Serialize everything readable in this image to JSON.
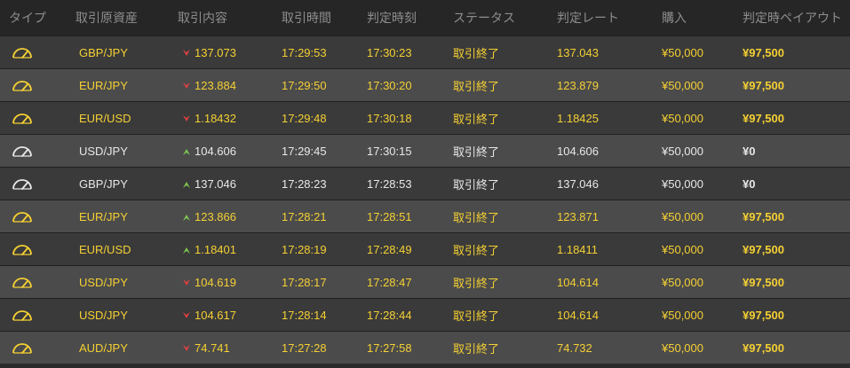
{
  "headers": [
    "タイプ",
    "取引原資産",
    "取引内容",
    "取引時間",
    "判定時刻",
    "ステータス",
    "判定レート",
    "購入",
    "判定時ペイアウト"
  ],
  "colors": {
    "win_text": "#f5d033",
    "lose_text": "#e8e8e8",
    "header_text": "#8d8d8d",
    "arrow_down": "#e04040",
    "arrow_up": "#7ec850"
  },
  "rows": [
    {
      "icon": "gauge-icon",
      "asset": "GBP/JPY",
      "dir": "down",
      "rate": "137.073",
      "time": "17:29:53",
      "judge_time": "17:30:23",
      "status": "取引終了",
      "judge_rate": "137.043",
      "purchase": "¥50,000",
      "payout": "¥97,500",
      "result": "win"
    },
    {
      "icon": "gauge-icon",
      "asset": "EUR/JPY",
      "dir": "down",
      "rate": "123.884",
      "time": "17:29:50",
      "judge_time": "17:30:20",
      "status": "取引終了",
      "judge_rate": "123.879",
      "purchase": "¥50,000",
      "payout": "¥97,500",
      "result": "win"
    },
    {
      "icon": "gauge-icon",
      "asset": "EUR/USD",
      "dir": "down",
      "rate": "1.18432",
      "time": "17:29:48",
      "judge_time": "17:30:18",
      "status": "取引終了",
      "judge_rate": "1.18425",
      "purchase": "¥50,000",
      "payout": "¥97,500",
      "result": "win"
    },
    {
      "icon": "gauge-icon",
      "asset": "USD/JPY",
      "dir": "up",
      "rate": "104.606",
      "time": "17:29:45",
      "judge_time": "17:30:15",
      "status": "取引終了",
      "judge_rate": "104.606",
      "purchase": "¥50,000",
      "payout": "¥0",
      "result": "lose"
    },
    {
      "icon": "gauge-icon",
      "asset": "GBP/JPY",
      "dir": "up",
      "rate": "137.046",
      "time": "17:28:23",
      "judge_time": "17:28:53",
      "status": "取引終了",
      "judge_rate": "137.046",
      "purchase": "¥50,000",
      "payout": "¥0",
      "result": "lose"
    },
    {
      "icon": "gauge-icon",
      "asset": "EUR/JPY",
      "dir": "up",
      "rate": "123.866",
      "time": "17:28:21",
      "judge_time": "17:28:51",
      "status": "取引終了",
      "judge_rate": "123.871",
      "purchase": "¥50,000",
      "payout": "¥97,500",
      "result": "win"
    },
    {
      "icon": "gauge-icon",
      "asset": "EUR/USD",
      "dir": "up",
      "rate": "1.18401",
      "time": "17:28:19",
      "judge_time": "17:28:49",
      "status": "取引終了",
      "judge_rate": "1.18411",
      "purchase": "¥50,000",
      "payout": "¥97,500",
      "result": "win"
    },
    {
      "icon": "gauge-icon",
      "asset": "USD/JPY",
      "dir": "down",
      "rate": "104.619",
      "time": "17:28:17",
      "judge_time": "17:28:47",
      "status": "取引終了",
      "judge_rate": "104.614",
      "purchase": "¥50,000",
      "payout": "¥97,500",
      "result": "win"
    },
    {
      "icon": "gauge-icon",
      "asset": "USD/JPY",
      "dir": "down",
      "rate": "104.617",
      "time": "17:28:14",
      "judge_time": "17:28:44",
      "status": "取引終了",
      "judge_rate": "104.614",
      "purchase": "¥50,000",
      "payout": "¥97,500",
      "result": "win"
    },
    {
      "icon": "gauge-icon",
      "asset": "AUD/JPY",
      "dir": "down",
      "rate": "74.741",
      "time": "17:27:28",
      "judge_time": "17:27:58",
      "status": "取引終了",
      "judge_rate": "74.732",
      "purchase": "¥50,000",
      "payout": "¥97,500",
      "result": "win"
    }
  ]
}
